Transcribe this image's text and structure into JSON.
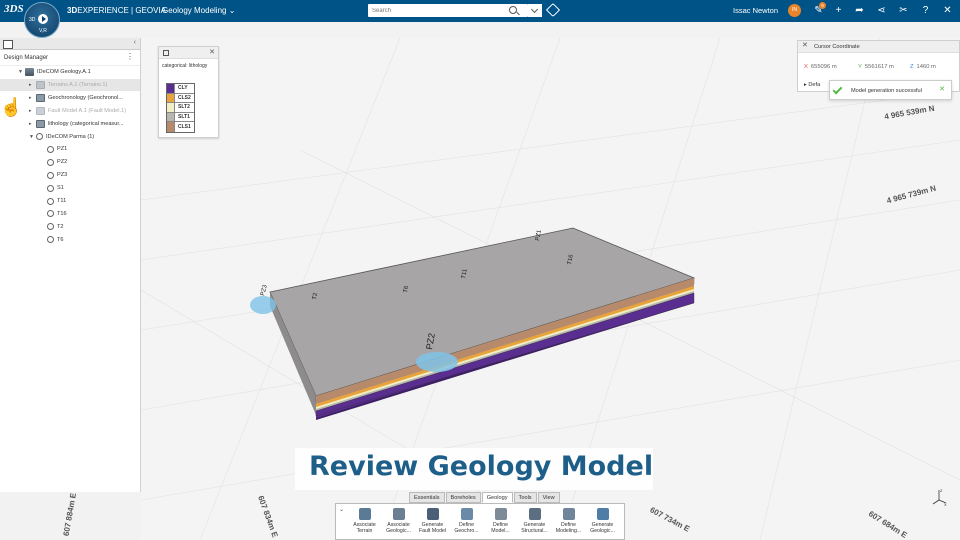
{
  "topbar": {
    "logo_text": "3DS",
    "compass_labels": [
      "3D",
      "V,R"
    ],
    "brand_prefix": "3D",
    "brand_rest": "EXPERIENCE | GEOVIA",
    "app_title": "Geology Modeling ⌄",
    "search_placeholder": "Search",
    "user_name": "Issac Newton",
    "avatar_initials": "IN",
    "notification_count": "9"
  },
  "left_panel": {
    "title": "Design Manager",
    "tree": [
      {
        "label": "IDeCOM Geology.A.1",
        "indent": 0,
        "twist": "▼",
        "icon": "geo",
        "state": "normal"
      },
      {
        "label": "Terrains A.1 (Terrains.1)",
        "indent": 1,
        "twist": "▸",
        "icon": "cube",
        "state": "dim-sel"
      },
      {
        "label": "Geochronology (Geochronol...",
        "indent": 1,
        "twist": "▸",
        "icon": "cube",
        "state": "normal"
      },
      {
        "label": "Fault Model A.1 (Fault Model.1)",
        "indent": 1,
        "twist": "▸",
        "icon": "cube",
        "state": "dim"
      },
      {
        "label": "lithology (categorical measur...",
        "indent": 1,
        "twist": "▸",
        "icon": "cube",
        "state": "normal"
      },
      {
        "label": "IDeCOM Parma (1)",
        "indent": 1,
        "twist": "▼",
        "icon": "bh",
        "state": "normal"
      },
      {
        "label": "PZ1",
        "indent": 2,
        "twist": "",
        "icon": "bh",
        "state": "normal"
      },
      {
        "label": "PZ2",
        "indent": 2,
        "twist": "",
        "icon": "bh",
        "state": "normal"
      },
      {
        "label": "PZ3",
        "indent": 2,
        "twist": "",
        "icon": "bh",
        "state": "normal"
      },
      {
        "label": "S1",
        "indent": 2,
        "twist": "",
        "icon": "bh",
        "state": "normal"
      },
      {
        "label": "T11",
        "indent": 2,
        "twist": "",
        "icon": "bh",
        "state": "normal"
      },
      {
        "label": "T16",
        "indent": 2,
        "twist": "",
        "icon": "bh",
        "state": "normal"
      },
      {
        "label": "T2",
        "indent": 2,
        "twist": "",
        "icon": "bh",
        "state": "normal"
      },
      {
        "label": "T6",
        "indent": 2,
        "twist": "",
        "icon": "bh",
        "state": "normal"
      }
    ]
  },
  "legend": {
    "title": "categorical: lithology",
    "items": [
      {
        "label": "CLY",
        "color": "#5a2d91"
      },
      {
        "label": "CLS2",
        "color": "#e8a33a"
      },
      {
        "label": "SLT2",
        "color": "#f3efc4"
      },
      {
        "label": "SLT1",
        "color": "#b7b7b0"
      },
      {
        "label": "CLS1",
        "color": "#b88a6c"
      }
    ]
  },
  "coord_panel": {
    "title": "Cursor Coordinate",
    "x_label": "X",
    "x_value": "655096 m",
    "y_label": "Y",
    "y_value": "5561617 m",
    "z_label": "Z",
    "z_value": "1460 m",
    "default_label": "Defa"
  },
  "toast": {
    "message": "Model generation successful"
  },
  "viewport": {
    "north_labels": [
      "4 965 539m N",
      "4 965 739m N"
    ],
    "east_labels": [
      "607 884m E",
      "607 834m E",
      "607 734m E",
      "607 684m E"
    ],
    "boreholes": [
      "PZ3",
      "PZ1",
      "T2",
      "T6",
      "T11",
      "T16",
      "PZ2"
    ]
  },
  "overlay_title": "Review Geology Model",
  "action_bar": {
    "tabs": [
      "Essentials",
      "Boreholes",
      "Geology",
      "Tools",
      "View"
    ],
    "active_tab": "Geology",
    "buttons": [
      {
        "label": "Associate Terrain"
      },
      {
        "label": "Associate Geologic..."
      },
      {
        "label": "Generate Fault Model"
      },
      {
        "label": "Define Geochro..."
      },
      {
        "label": "Define Model..."
      },
      {
        "label": "Generate Structural..."
      },
      {
        "label": "Define Modeling..."
      },
      {
        "label": "Generate Geologic..."
      }
    ]
  },
  "axis_triad": {
    "z": "Z",
    "x": "X"
  }
}
